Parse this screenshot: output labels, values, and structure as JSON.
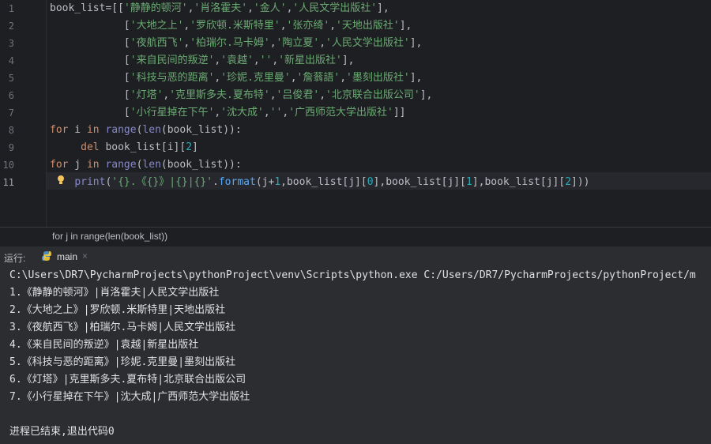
{
  "editor": {
    "line_numbers": [
      "1",
      "2",
      "3",
      "4",
      "5",
      "6",
      "7",
      "8",
      "9",
      "10",
      "11"
    ],
    "lines": [
      [
        [
          "v",
          "book_list"
        ],
        [
          "punc",
          "=[["
        ],
        [
          "s",
          "'静静的顿河'"
        ],
        [
          "punc",
          ","
        ],
        [
          "s",
          "'肖洛霍夫'"
        ],
        [
          "punc",
          ","
        ],
        [
          "s",
          "'金人'"
        ],
        [
          "punc",
          ","
        ],
        [
          "s",
          "'人民文学出版社'"
        ],
        [
          "punc",
          "],"
        ]
      ],
      [
        [
          "v",
          "            "
        ],
        [
          "punc",
          "["
        ],
        [
          "s",
          "'大地之上'"
        ],
        [
          "punc",
          ","
        ],
        [
          "s",
          "'罗欣顿.米斯特里'"
        ],
        [
          "punc",
          ","
        ],
        [
          "s",
          "'张亦绮'"
        ],
        [
          "punc",
          ","
        ],
        [
          "s",
          "'天地出版社'"
        ],
        [
          "punc",
          "],"
        ]
      ],
      [
        [
          "v",
          "            "
        ],
        [
          "punc",
          "["
        ],
        [
          "s",
          "'夜航西飞'"
        ],
        [
          "punc",
          ","
        ],
        [
          "s",
          "'柏瑞尔.马卡姆'"
        ],
        [
          "punc",
          ","
        ],
        [
          "s",
          "'陶立夏'"
        ],
        [
          "punc",
          ","
        ],
        [
          "s",
          "'人民文学出版社'"
        ],
        [
          "punc",
          "],"
        ]
      ],
      [
        [
          "v",
          "            "
        ],
        [
          "punc",
          "["
        ],
        [
          "s",
          "'来自民间的叛逆'"
        ],
        [
          "punc",
          ","
        ],
        [
          "s",
          "'袁越'"
        ],
        [
          "punc",
          ","
        ],
        [
          "s",
          "''"
        ],
        [
          "punc",
          ","
        ],
        [
          "s",
          "'新星出版社'"
        ],
        [
          "punc",
          "],"
        ]
      ],
      [
        [
          "v",
          "            "
        ],
        [
          "punc",
          "["
        ],
        [
          "s",
          "'科技与恶的距离'"
        ],
        [
          "punc",
          ","
        ],
        [
          "s",
          "'珍妮.克里曼'"
        ],
        [
          "punc",
          ","
        ],
        [
          "s",
          "'詹蓊語'"
        ],
        [
          "punc",
          ","
        ],
        [
          "s",
          "'墨刻出版社'"
        ],
        [
          "punc",
          "],"
        ]
      ],
      [
        [
          "v",
          "            "
        ],
        [
          "punc",
          "["
        ],
        [
          "s",
          "'灯塔'"
        ],
        [
          "punc",
          ","
        ],
        [
          "s",
          "'克里斯多夫.夏布特'"
        ],
        [
          "punc",
          ","
        ],
        [
          "s",
          "'吕俊君'"
        ],
        [
          "punc",
          ","
        ],
        [
          "s",
          "'北京联合出版公司'"
        ],
        [
          "punc",
          "],"
        ]
      ],
      [
        [
          "v",
          "            "
        ],
        [
          "punc",
          "["
        ],
        [
          "s",
          "'小行星掉在下午'"
        ],
        [
          "punc",
          ","
        ],
        [
          "s",
          "'沈大成'"
        ],
        [
          "punc",
          ","
        ],
        [
          "s",
          "''"
        ],
        [
          "punc",
          ","
        ],
        [
          "s",
          "'广西师范大学出版社'"
        ],
        [
          "punc",
          "]]"
        ]
      ],
      [
        [
          "k",
          "for"
        ],
        [
          "v",
          " i "
        ],
        [
          "k",
          "in"
        ],
        [
          "v",
          " "
        ],
        [
          "b",
          "range"
        ],
        [
          "punc",
          "("
        ],
        [
          "b",
          "len"
        ],
        [
          "punc",
          "("
        ],
        [
          "v",
          "book_list"
        ],
        [
          "punc",
          "))"
        ],
        [
          "punc",
          ":"
        ]
      ],
      [
        [
          "v",
          "     "
        ],
        [
          "k",
          "del"
        ],
        [
          "v",
          " book_list[i]["
        ],
        [
          "n",
          "2"
        ],
        [
          "punc",
          "]"
        ]
      ],
      [
        [
          "k",
          "for"
        ],
        [
          "v",
          " j "
        ],
        [
          "k",
          "in"
        ],
        [
          "v",
          " "
        ],
        [
          "b",
          "range"
        ],
        [
          "punc",
          "("
        ],
        [
          "b",
          "len"
        ],
        [
          "punc",
          "("
        ],
        [
          "v",
          "book_list"
        ],
        [
          "punc",
          "))"
        ],
        [
          "punc",
          ":"
        ]
      ],
      [
        [
          "v",
          "    "
        ],
        [
          "b",
          "print"
        ],
        [
          "punc",
          "("
        ],
        [
          "s",
          "'{}.《{}》|{}|{}'"
        ],
        [
          "punc",
          "."
        ],
        [
          "f",
          "format"
        ],
        [
          "punc",
          "("
        ],
        [
          "v",
          "j+"
        ],
        [
          "n",
          "1"
        ],
        [
          "punc",
          ","
        ],
        [
          "v",
          "book_list[j]["
        ],
        [
          "n",
          "0"
        ],
        [
          "punc",
          "]"
        ],
        [
          "punc",
          ","
        ],
        [
          "v",
          "book_list[j]["
        ],
        [
          "n",
          "1"
        ],
        [
          "punc",
          "]"
        ],
        [
          "punc",
          ","
        ],
        [
          "v",
          "book_list[j]["
        ],
        [
          "n",
          "2"
        ],
        [
          "punc",
          "])"
        ],
        [
          "punc",
          ")"
        ]
      ]
    ]
  },
  "breadcrumb": {
    "text": "for j in range(len(book_list))"
  },
  "run_panel": {
    "label": "运行:",
    "tab_name": "main",
    "close_glyph": "×"
  },
  "console": {
    "lines": [
      "C:\\Users\\DR7\\PycharmProjects\\pythonProject\\venv\\Scripts\\python.exe C:/Users/DR7/PycharmProjects/pythonProject/m",
      "1.《静静的顿河》|肖洛霍夫|人民文学出版社",
      "2.《大地之上》|罗欣顿.米斯特里|天地出版社",
      "3.《夜航西飞》|柏瑞尔.马卡姆|人民文学出版社",
      "4.《来自民间的叛逆》|袁越|新星出版社",
      "5.《科技与恶的距离》|珍妮.克里曼|墨刻出版社",
      "6.《灯塔》|克里斯多夫.夏布特|北京联合出版公司",
      "7.《小行星掉在下午》|沈大成|广西师范大学出版社",
      "",
      "进程已结束,退出代码0"
    ]
  },
  "colors": {
    "editor_bg": "#1e1f22",
    "panel_bg": "#2b2d30",
    "keyword": "#cf8e6d",
    "string": "#6aab73",
    "number": "#2aacb8",
    "builtin": "#8888c6",
    "function": "#56a8f5"
  }
}
